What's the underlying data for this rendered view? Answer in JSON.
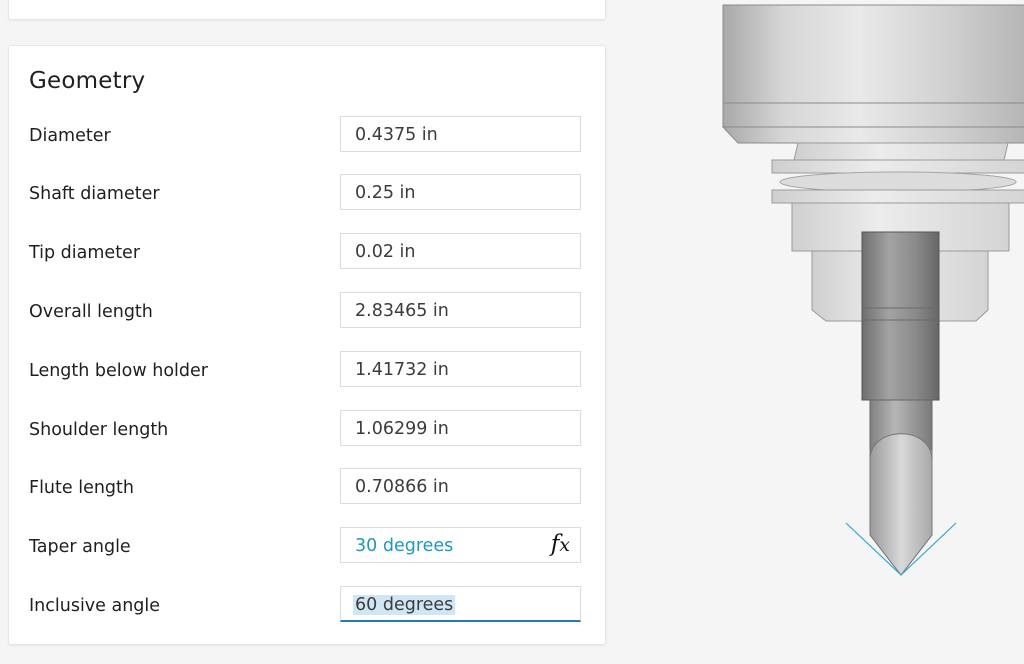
{
  "panel": {
    "title": "Geometry",
    "fields": [
      {
        "label": "Diameter",
        "value": "0.4375 in"
      },
      {
        "label": "Shaft diameter",
        "value": "0.25 in"
      },
      {
        "label": "Tip diameter",
        "value": "0.02 in"
      },
      {
        "label": "Overall length",
        "value": "2.83465 in"
      },
      {
        "label": "Length below holder",
        "value": "1.41732 in"
      },
      {
        "label": "Shoulder length",
        "value": "1.06299 in"
      },
      {
        "label": "Flute length",
        "value": "0.70866 in"
      },
      {
        "label": "Taper angle",
        "value": "30 degrees",
        "formula_icon": "fx-icon"
      },
      {
        "label": "Inclusive angle",
        "value": "60 degrees",
        "state": "editing"
      }
    ]
  },
  "colors": {
    "formula_text": "#1c98c4",
    "active_underline": "#1f7fb3",
    "selection": "#cfe6f4",
    "angle_guide": "#2aa6d6"
  }
}
